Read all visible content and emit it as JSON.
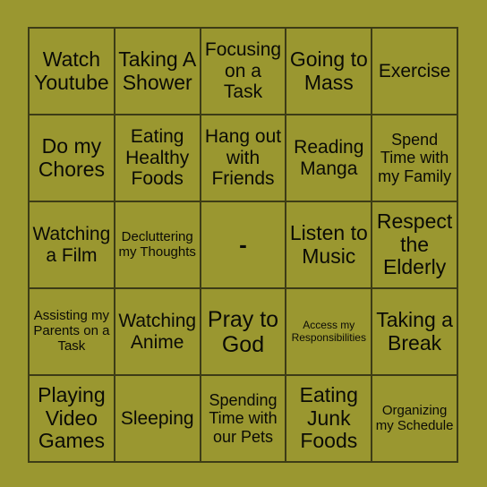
{
  "card": {
    "type": "bingo-card",
    "rows": 5,
    "columns": 5,
    "colors": {
      "background": "#9a9730",
      "cell_fill": "#9a9730",
      "grid_line": "#3d3c16",
      "text": "#0b0b06"
    },
    "cells": [
      [
        {
          "text": "Watch Youtube",
          "size": "lg"
        },
        {
          "text": "Taking A Shower",
          "size": "lg"
        },
        {
          "text": "Focusing on a Task",
          "size": "md"
        },
        {
          "text": "Going to Mass",
          "size": "lg"
        },
        {
          "text": "Exercise",
          "size": "md"
        }
      ],
      [
        {
          "text": "Do my Chores",
          "size": "lg"
        },
        {
          "text": "Eating Healthy Foods",
          "size": "md"
        },
        {
          "text": "Hang out with Friends",
          "size": "md"
        },
        {
          "text": "Reading Manga",
          "size": "md"
        },
        {
          "text": "Spend Time with my Family",
          "size": "sm"
        }
      ],
      [
        {
          "text": "Watching a Film",
          "size": "md"
        },
        {
          "text": "Decluttering my Thoughts",
          "size": "xs"
        },
        {
          "text": "-",
          "size": "free"
        },
        {
          "text": "Listen to Music",
          "size": "lg"
        },
        {
          "text": "Respect the Elderly",
          "size": "lg"
        }
      ],
      [
        {
          "text": "Assisting my Parents on a Task",
          "size": "xs"
        },
        {
          "text": "Watching Anime",
          "size": "md"
        },
        {
          "text": "Pray to God",
          "size": "xl"
        },
        {
          "text": "Access my Responsibilities",
          "size": "xxs"
        },
        {
          "text": "Taking a Break",
          "size": "lg"
        }
      ],
      [
        {
          "text": "Playing Video Games",
          "size": "lg"
        },
        {
          "text": "Sleeping",
          "size": "md"
        },
        {
          "text": "Spending Time with our Pets",
          "size": "sm"
        },
        {
          "text": "Eating Junk Foods",
          "size": "lg"
        },
        {
          "text": "Organizing my Schedule",
          "size": "xs"
        }
      ]
    ]
  }
}
